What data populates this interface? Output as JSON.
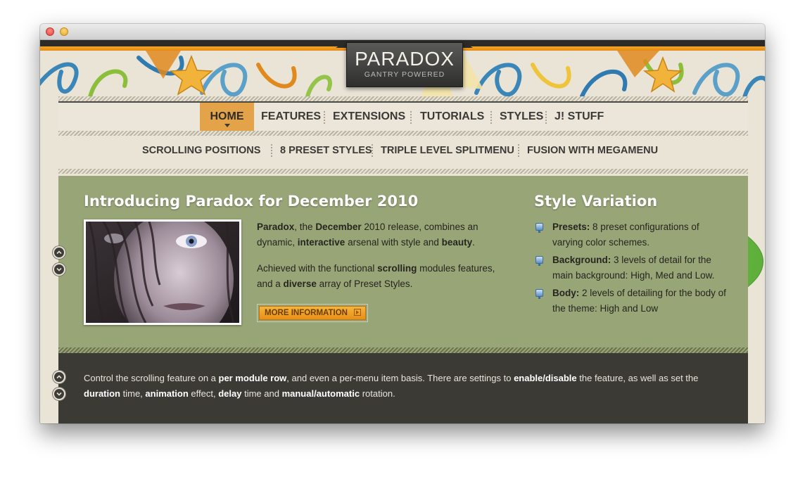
{
  "logo": {
    "title": "PARADOX",
    "subtitle": "GANTRY POWERED"
  },
  "main_nav": {
    "items": [
      {
        "label": "HOME",
        "active": true
      },
      {
        "label": "FEATURES"
      },
      {
        "label": "EXTENSIONS"
      },
      {
        "label": "TUTORIALS"
      },
      {
        "label": "STYLES"
      },
      {
        "label": "J! STUFF"
      }
    ]
  },
  "sub_nav": {
    "items": [
      {
        "label": "SCROLLING POSITIONS"
      },
      {
        "label": "8 PRESET STYLES"
      },
      {
        "label": "TRIPLE LEVEL SPLITMENU"
      },
      {
        "label": "FUSION WITH MEGAMENU"
      }
    ]
  },
  "intro": {
    "title": "Introducing Paradox for December 2010",
    "p1": {
      "b1": "Paradox",
      "t1": ", the ",
      "b2": "December",
      "t2": " 2010 release, combines an dynamic, ",
      "b3": "interactive",
      "t3": " arsenal with style and ",
      "b4": "beauty",
      "t4": "."
    },
    "p2": {
      "t1": "Achieved with the functional ",
      "b1": "scrolling",
      "t2": " modules features, and a ",
      "b2": "diverse",
      "t3": " array of Preset Styles."
    },
    "button_label": "MORE INFORMATION"
  },
  "style_variation": {
    "title": "Style Variation",
    "items": [
      {
        "label": "Presets:",
        "text": " 8 preset configurations of varying color schemes."
      },
      {
        "label": "Background:",
        "text": " 3 levels of detail for the main background: High, Med and Low."
      },
      {
        "label": "Body:",
        "text": " 2 levels of detailing for the body of the theme: High and Low"
      }
    ]
  },
  "footer_row": {
    "t1": "Control the scrolling feature on a ",
    "b1": "per module row",
    "t2": ", and even a per-menu item basis. There are settings to ",
    "b2": "enable/disable",
    "t3": " the feature, as well as set the ",
    "b3": "duration",
    "t4": " time, ",
    "b4": "animation",
    "t5": " effect, ",
    "b5": "delay",
    "t6": " time and ",
    "b6": "manual/automatic",
    "t7": " rotation."
  },
  "colors": {
    "accent": "#e5a349",
    "panel_green": "#97a577",
    "panel_dark": "#3c3a35",
    "button_orange": "#f0a12c"
  }
}
